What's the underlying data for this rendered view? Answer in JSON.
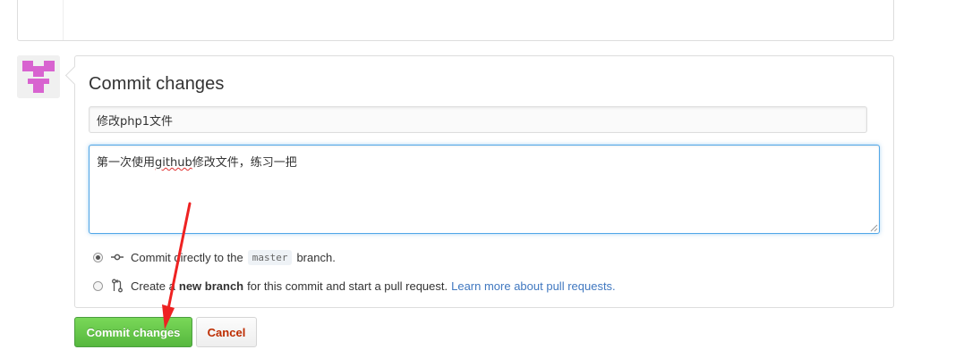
{
  "commit": {
    "title": "Commit changes",
    "summary_value": "修改php1文件",
    "description_before": "第一次使用",
    "description_misspelled": "github",
    "description_after": "修改文件，练习一把"
  },
  "options": {
    "direct_prefix": "Commit directly to the",
    "branch_name": "master",
    "direct_suffix": "branch.",
    "new_prefix": "Create a",
    "new_strong": "new branch",
    "new_suffix": "for this commit and start a pull request.",
    "learn_more_link": "Learn more about pull requests."
  },
  "buttons": {
    "commit_label": "Commit changes",
    "cancel_label": "Cancel"
  },
  "icons": {
    "direct_commit": "git-commit-icon",
    "new_branch": "git-pull-request-icon",
    "annotation": "red-arrow-annotation"
  },
  "colors": {
    "commit_button": "#5cbd42",
    "cancel_text": "#bd2c00",
    "link": "#4078c0",
    "focus_border": "#51a7e8",
    "avatar": "#d863d0",
    "arrow": "#ee2222"
  }
}
